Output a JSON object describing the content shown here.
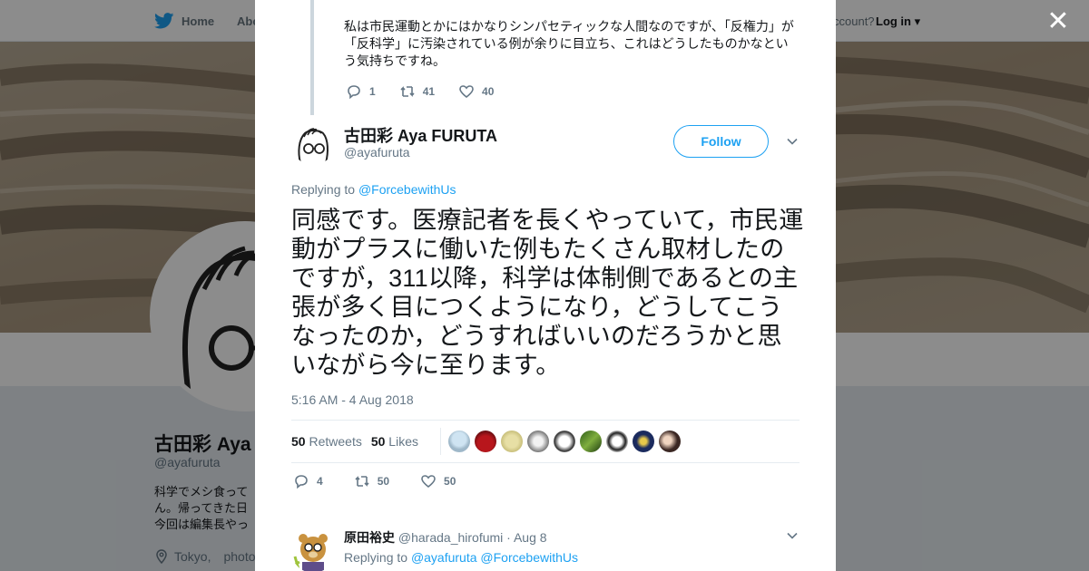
{
  "background": {
    "nav": {
      "home": "Home",
      "about": "Abo",
      "account": "ccount?",
      "login": "Log in"
    },
    "profile": {
      "name": "古田彩 Aya",
      "handle": "@ayafuruta",
      "bio_lines": [
        "科学でメシ食って",
        "ん。帰ってきた日",
        "今回は編集長やっ"
      ],
      "location": "Tokyo,",
      "location_extra": "photo"
    }
  },
  "modal": {
    "parent_tweet": {
      "text": "私は市民運動とかにはかなりシンパセティックな人間なのですが、「反権力」が「反科学」に汚染されている例が余りに目立ち、これはどうしたものかなという気持ちですね。",
      "replies": "1",
      "retweets": "41",
      "likes": "40"
    },
    "author": {
      "name": "古田彩 Aya FURUTA",
      "handle": "@ayafuruta",
      "follow": "Follow"
    },
    "replying_prefix": "Replying to",
    "replying_to": "@ForcebewithUs",
    "tweet_text": "同感です。医療記者を長くやっていて，市民運動がプラスに働いた例もたくさん取材したのですが，311以降，科学は体制側であるとの主張が多く目につくようになり，どうしてこうなったのか，どうすればいいのだろうかと思いながら今に至ります。",
    "timestamp": "5:16 AM - 4 Aug 2018",
    "stats": {
      "retweets_count": "50",
      "retweets_label": "Retweets",
      "likes_count": "50",
      "likes_label": "Likes"
    },
    "actions": {
      "replies": "4",
      "retweets": "50",
      "likes": "50"
    },
    "reply": {
      "name": "原田裕史",
      "handle": "@harada_hirofumi",
      "date": "· Aug 8",
      "replying_prefix": "Replying to",
      "replying_to_1": "@ayafuruta",
      "replying_to_2": "@ForcebewithUs"
    }
  },
  "colors": {
    "accent": "#1da1f2",
    "text": "#14171a",
    "muted": "#657786"
  },
  "icons": [
    "twitter-bird-icon",
    "close-icon",
    "reply-icon",
    "retweet-icon",
    "heart-icon",
    "chevron-down-icon",
    "location-pin-icon"
  ]
}
